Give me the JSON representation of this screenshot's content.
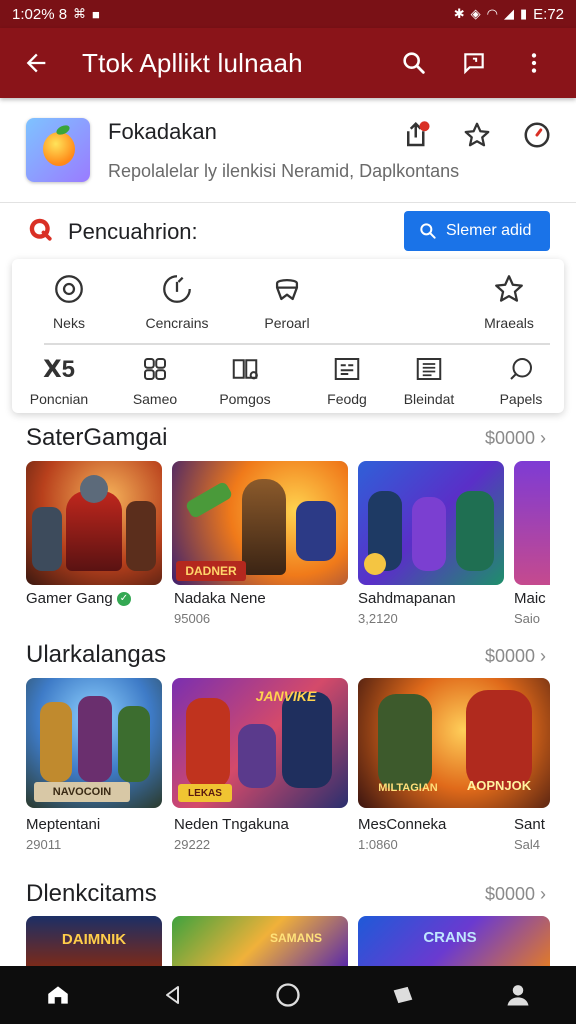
{
  "status_bar": {
    "time_left": "1:02% 8",
    "time_right": "E:72"
  },
  "app_bar": {
    "title": "Ttok Apllikt lulnaah",
    "back_icon": "arrow-left-icon",
    "actions": [
      "search-icon",
      "feedback-icon",
      "more-vert-icon"
    ]
  },
  "app_info": {
    "name": "Fokadakan",
    "subtitle": "Repolalelar ly ilenkisi Neramid, Daplkontans",
    "actions": [
      "share-badge-icon",
      "star-outline-icon",
      "timer-icon"
    ]
  },
  "search_section": {
    "label": "Pencuahrion:",
    "button_label": "Slemer adid"
  },
  "categories_top": [
    {
      "label": "Neks",
      "icon": "target-icon"
    },
    {
      "label": "Cencrains",
      "icon": "compass-icon"
    },
    {
      "label": "Peroarl",
      "icon": "badge-icon"
    },
    {
      "label": "Mraeals",
      "icon": "star-icon"
    }
  ],
  "categories_bottom": [
    {
      "label": "Poncnian",
      "icon": "x5-icon",
      "glyph": "ꓫ5"
    },
    {
      "label": "Sameo",
      "icon": "grid-icon"
    },
    {
      "label": "Pomgos",
      "icon": "columns-icon"
    },
    {
      "label": "Feodg",
      "icon": "feed-icon"
    },
    {
      "label": "Bleindat",
      "icon": "list-icon"
    },
    {
      "label": "Papels",
      "icon": "chat-icon"
    }
  ],
  "sections": [
    {
      "title": "SaterGamgai",
      "more": "$0000",
      "games": [
        {
          "name": "Gamer Gang",
          "sub": "",
          "verified": true
        },
        {
          "name": "Nadaka Nene",
          "sub": "95006",
          "banner": "DADNER"
        },
        {
          "name": "Sahdmapanan",
          "sub": "3,2120"
        },
        {
          "name": "Maic",
          "sub": "Saio"
        }
      ]
    },
    {
      "title": "Ularkalangas",
      "more": "$0000",
      "games": [
        {
          "name": "Meptentani",
          "sub": "29011",
          "banner": "NAVOCOIN"
        },
        {
          "name": "Neden Tngakuna",
          "sub": "29222",
          "banner": "JANVIKE"
        },
        {
          "name": "MesConneka",
          "sub": "1:0860",
          "banner": "AOPNJOK"
        },
        {
          "name": "Sant",
          "sub": "Sal4"
        }
      ]
    },
    {
      "title": "Dlenkcitams",
      "more": "$0000",
      "games": [
        {
          "name": "",
          "sub": "",
          "banner": "DAIMNIK"
        },
        {
          "name": "",
          "sub": "",
          "banner": "SAMANS"
        },
        {
          "name": "",
          "sub": "",
          "banner": "CRANS"
        }
      ]
    }
  ],
  "bottom_nav": [
    "home-icon",
    "back-triangle-icon",
    "home-circle-icon",
    "recent-icon",
    "profile-icon"
  ],
  "colors": {
    "app_bar": "#8a1419",
    "accent_blue": "#1a73e8",
    "verified_green": "#34a853"
  }
}
